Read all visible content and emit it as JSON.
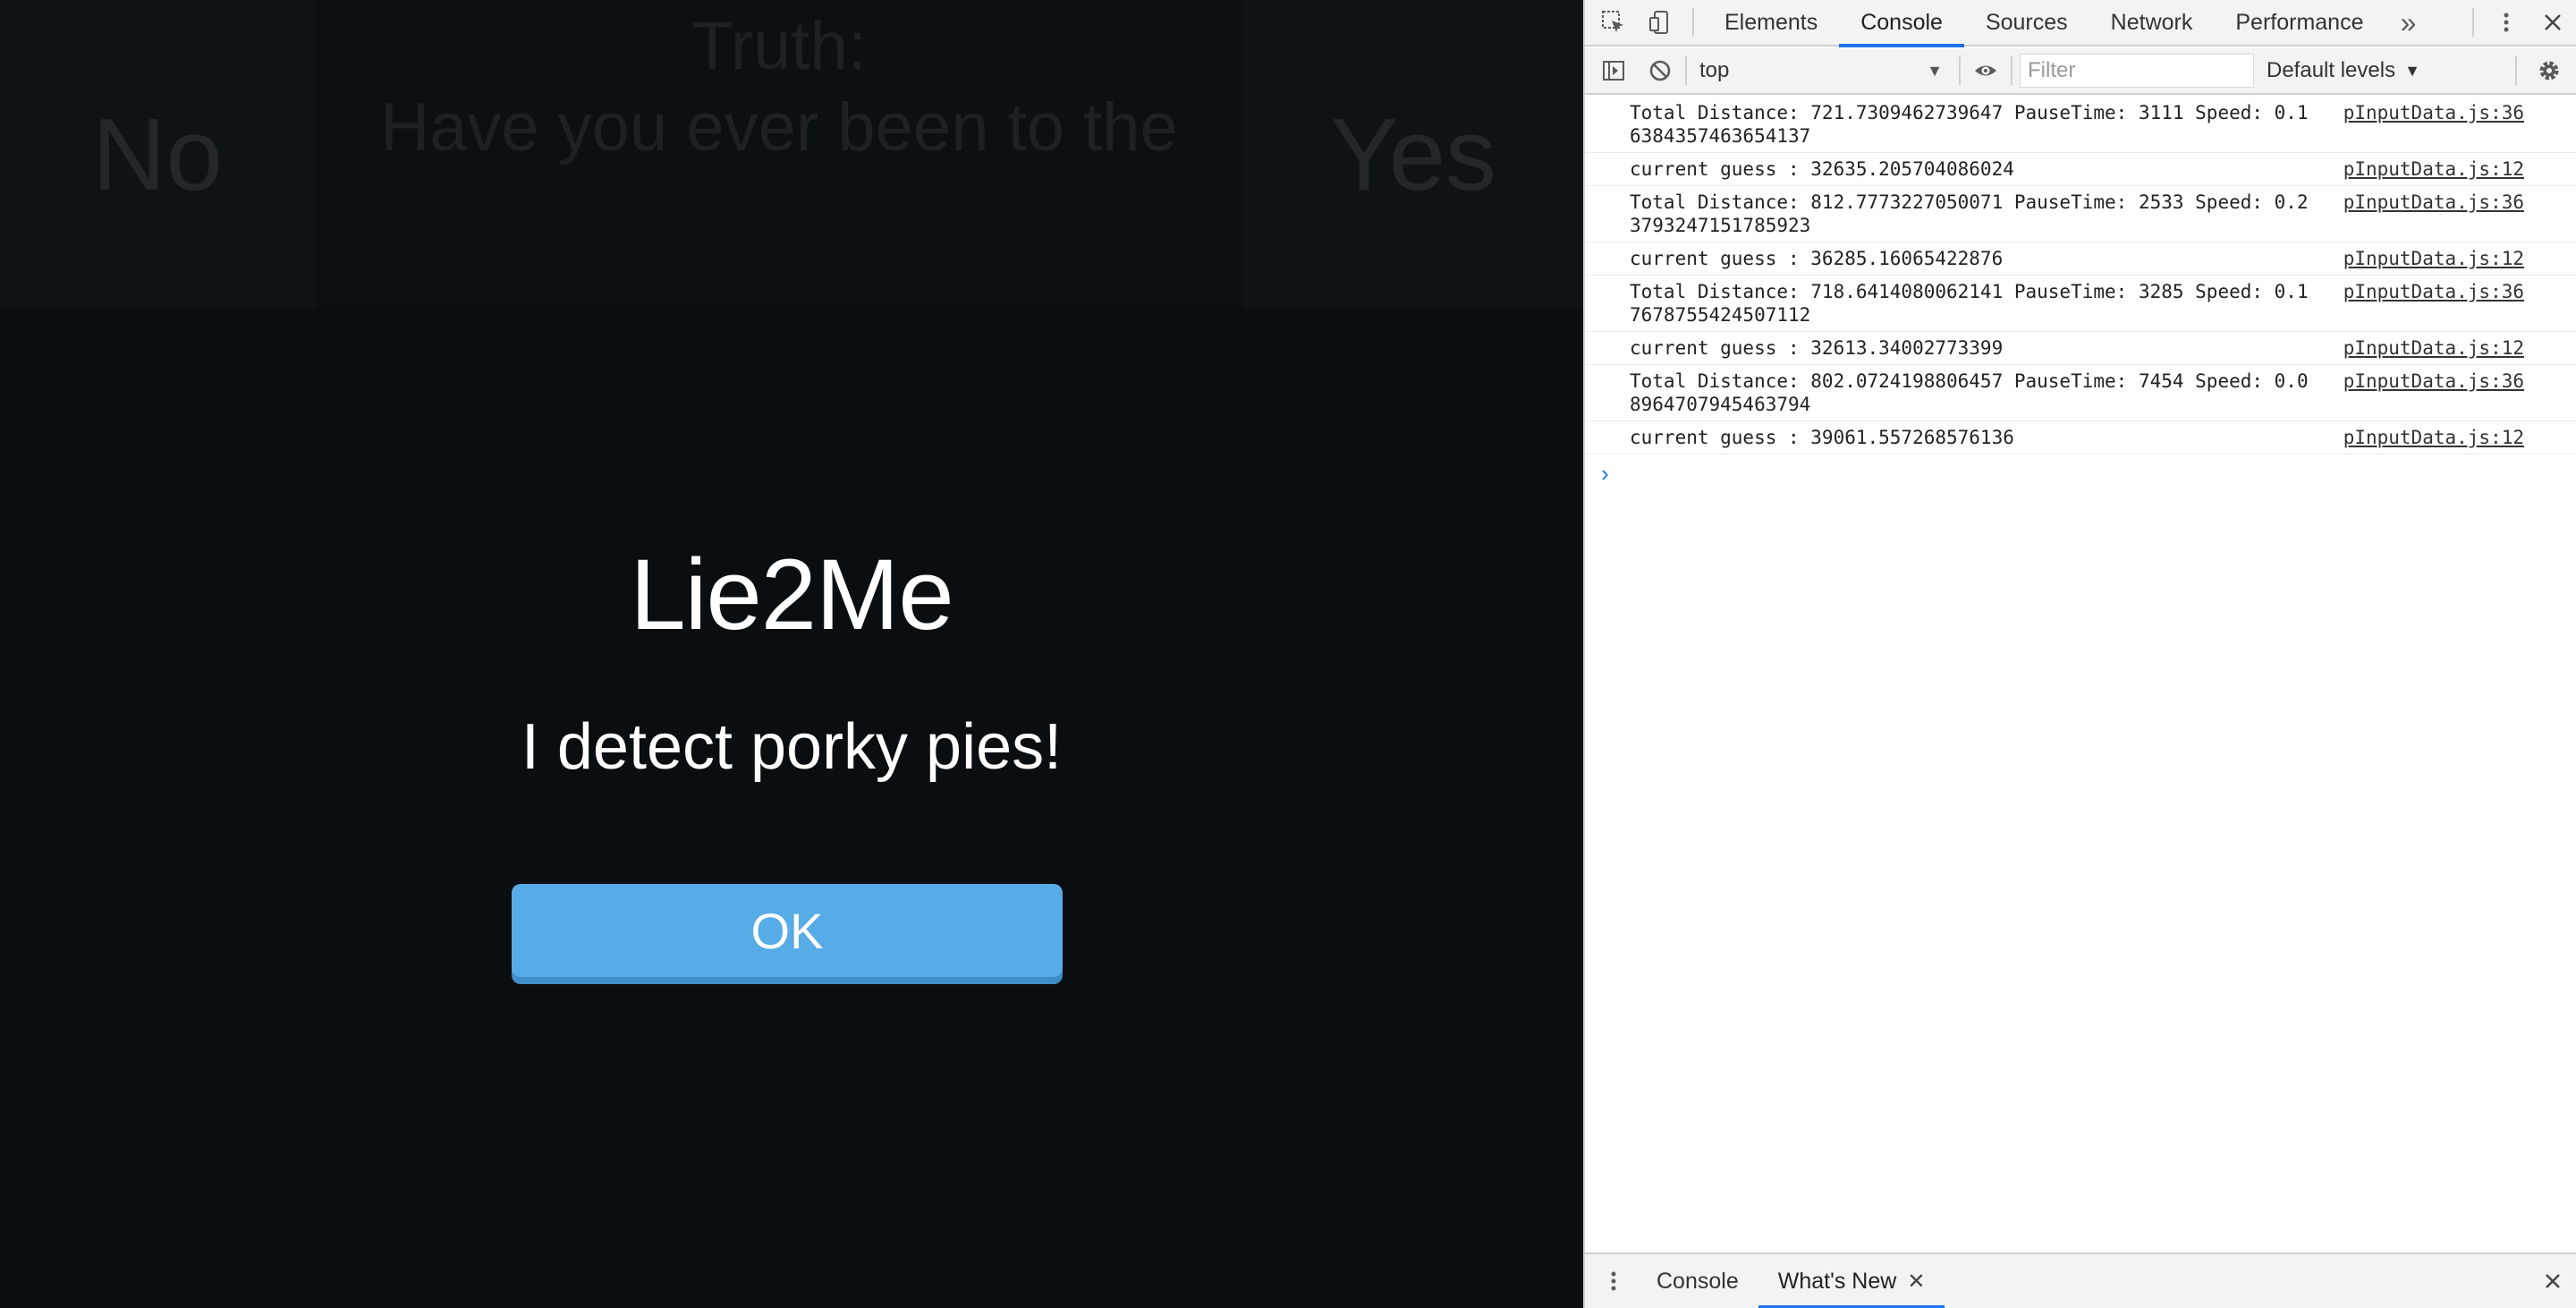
{
  "game": {
    "no_label": "No",
    "yes_label": "Yes",
    "question_title": "Truth:",
    "question_text": "Have you ever been to the",
    "modal": {
      "title": "Lie2Me",
      "message": "I detect porky pies!",
      "ok_label": "OK"
    }
  },
  "devtools": {
    "tabs": [
      {
        "label": "Elements",
        "active": false
      },
      {
        "label": "Console",
        "active": true
      },
      {
        "label": "Sources",
        "active": false
      },
      {
        "label": "Network",
        "active": false
      },
      {
        "label": "Performance",
        "active": false
      }
    ],
    "more_tabs_icon": "»",
    "toolbar": {
      "context": "top",
      "filter_placeholder": "Filter",
      "levels_label": "Default levels"
    },
    "logs": [
      {
        "message": "Total Distance: 721.7309462739647 PauseTime: 3111 Speed: 0.16384357463654137",
        "source": "pInputData.js:36"
      },
      {
        "message": "current guess : 32635.205704086024",
        "source": "pInputData.js:12"
      },
      {
        "message": "Total Distance: 812.7773227050071 PauseTime: 2533 Speed: 0.23793247151785923",
        "source": "pInputData.js:36"
      },
      {
        "message": "current guess : 36285.16065422876",
        "source": "pInputData.js:12"
      },
      {
        "message": "Total Distance: 718.6414080062141 PauseTime: 3285 Speed: 0.17678755424507112",
        "source": "pInputData.js:36"
      },
      {
        "message": "current guess : 32613.34002773399",
        "source": "pInputData.js:12"
      },
      {
        "message": "Total Distance: 802.0724198806457 PauseTime: 7454 Speed: 0.08964707945463794",
        "source": "pInputData.js:36"
      },
      {
        "message": "current guess : 39061.557268576136",
        "source": "pInputData.js:12"
      }
    ],
    "prompt_symbol": "›",
    "drawer": {
      "tabs": [
        {
          "label": "Console",
          "active": false
        },
        {
          "label": "What's New",
          "active": true,
          "closable": true
        }
      ],
      "close_tab_symbol": "✕",
      "close_symbol": "✕"
    }
  }
}
